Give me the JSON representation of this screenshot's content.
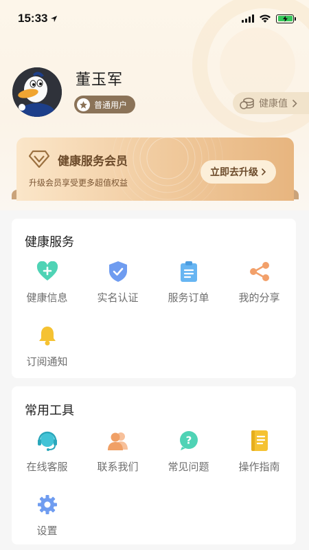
{
  "status_bar": {
    "time": "15:33"
  },
  "profile": {
    "name": "董玉军",
    "level_badge": "普通用户",
    "health_value_label": "健康值"
  },
  "member_card": {
    "title": "健康服务会员",
    "subtitle": "升级会员享受更多超值权益",
    "upgrade_label": "立即去升级"
  },
  "health_services": {
    "title": "健康服务",
    "items": [
      {
        "label": "健康信息",
        "icon": "heart-plus-icon",
        "color": "#4fd3b5"
      },
      {
        "label": "实名认证",
        "icon": "shield-check-icon",
        "color": "#6f9cf0"
      },
      {
        "label": "服务订单",
        "icon": "clipboard-icon",
        "color": "#67b5f2"
      },
      {
        "label": "我的分享",
        "icon": "share-icon",
        "color": "#f2a06a"
      },
      {
        "label": "订阅通知",
        "icon": "bell-icon",
        "color": "#f5c232"
      }
    ]
  },
  "common_tools": {
    "title": "常用工具",
    "items": [
      {
        "label": "在线客服",
        "icon": "headset-icon",
        "color": "#41c3d6"
      },
      {
        "label": "联系我们",
        "icon": "contacts-icon",
        "color": "#f0a066"
      },
      {
        "label": "常见问题",
        "icon": "question-icon",
        "color": "#4fd3b5"
      },
      {
        "label": "操作指南",
        "icon": "guide-book-icon",
        "color": "#f5c232"
      },
      {
        "label": "设置",
        "icon": "gear-icon",
        "color": "#6f9cf0"
      }
    ]
  }
}
